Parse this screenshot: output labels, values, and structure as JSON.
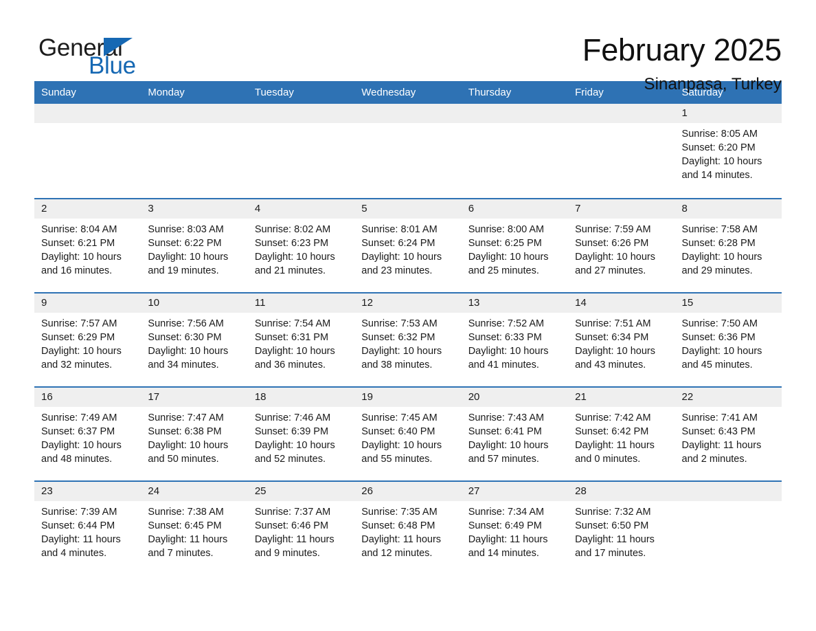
{
  "brand": {
    "name_part1": "General",
    "name_part2": "Blue",
    "flag_icon": "triangle-flag-icon"
  },
  "header": {
    "title": "February 2025",
    "subtitle": "Sinanpasa, Turkey"
  },
  "calendar": {
    "weekday_headers": [
      "Sunday",
      "Monday",
      "Tuesday",
      "Wednesday",
      "Thursday",
      "Friday",
      "Saturday"
    ],
    "header_bg": "#2e72b4",
    "daynum_bg": "#efefef",
    "row_divider": "#2e72b4",
    "weeks": [
      [
        {
          "day": "",
          "empty": true
        },
        {
          "day": "",
          "empty": true
        },
        {
          "day": "",
          "empty": true
        },
        {
          "day": "",
          "empty": true
        },
        {
          "day": "",
          "empty": true
        },
        {
          "day": "",
          "empty": true
        },
        {
          "day": "1",
          "sunrise": "Sunrise: 8:05 AM",
          "sunset": "Sunset: 6:20 PM",
          "daylight": "Daylight: 10 hours and 14 minutes."
        }
      ],
      [
        {
          "day": "2",
          "sunrise": "Sunrise: 8:04 AM",
          "sunset": "Sunset: 6:21 PM",
          "daylight": "Daylight: 10 hours and 16 minutes."
        },
        {
          "day": "3",
          "sunrise": "Sunrise: 8:03 AM",
          "sunset": "Sunset: 6:22 PM",
          "daylight": "Daylight: 10 hours and 19 minutes."
        },
        {
          "day": "4",
          "sunrise": "Sunrise: 8:02 AM",
          "sunset": "Sunset: 6:23 PM",
          "daylight": "Daylight: 10 hours and 21 minutes."
        },
        {
          "day": "5",
          "sunrise": "Sunrise: 8:01 AM",
          "sunset": "Sunset: 6:24 PM",
          "daylight": "Daylight: 10 hours and 23 minutes."
        },
        {
          "day": "6",
          "sunrise": "Sunrise: 8:00 AM",
          "sunset": "Sunset: 6:25 PM",
          "daylight": "Daylight: 10 hours and 25 minutes."
        },
        {
          "day": "7",
          "sunrise": "Sunrise: 7:59 AM",
          "sunset": "Sunset: 6:26 PM",
          "daylight": "Daylight: 10 hours and 27 minutes."
        },
        {
          "day": "8",
          "sunrise": "Sunrise: 7:58 AM",
          "sunset": "Sunset: 6:28 PM",
          "daylight": "Daylight: 10 hours and 29 minutes."
        }
      ],
      [
        {
          "day": "9",
          "sunrise": "Sunrise: 7:57 AM",
          "sunset": "Sunset: 6:29 PM",
          "daylight": "Daylight: 10 hours and 32 minutes."
        },
        {
          "day": "10",
          "sunrise": "Sunrise: 7:56 AM",
          "sunset": "Sunset: 6:30 PM",
          "daylight": "Daylight: 10 hours and 34 minutes."
        },
        {
          "day": "11",
          "sunrise": "Sunrise: 7:54 AM",
          "sunset": "Sunset: 6:31 PM",
          "daylight": "Daylight: 10 hours and 36 minutes."
        },
        {
          "day": "12",
          "sunrise": "Sunrise: 7:53 AM",
          "sunset": "Sunset: 6:32 PM",
          "daylight": "Daylight: 10 hours and 38 minutes."
        },
        {
          "day": "13",
          "sunrise": "Sunrise: 7:52 AM",
          "sunset": "Sunset: 6:33 PM",
          "daylight": "Daylight: 10 hours and 41 minutes."
        },
        {
          "day": "14",
          "sunrise": "Sunrise: 7:51 AM",
          "sunset": "Sunset: 6:34 PM",
          "daylight": "Daylight: 10 hours and 43 minutes."
        },
        {
          "day": "15",
          "sunrise": "Sunrise: 7:50 AM",
          "sunset": "Sunset: 6:36 PM",
          "daylight": "Daylight: 10 hours and 45 minutes."
        }
      ],
      [
        {
          "day": "16",
          "sunrise": "Sunrise: 7:49 AM",
          "sunset": "Sunset: 6:37 PM",
          "daylight": "Daylight: 10 hours and 48 minutes."
        },
        {
          "day": "17",
          "sunrise": "Sunrise: 7:47 AM",
          "sunset": "Sunset: 6:38 PM",
          "daylight": "Daylight: 10 hours and 50 minutes."
        },
        {
          "day": "18",
          "sunrise": "Sunrise: 7:46 AM",
          "sunset": "Sunset: 6:39 PM",
          "daylight": "Daylight: 10 hours and 52 minutes."
        },
        {
          "day": "19",
          "sunrise": "Sunrise: 7:45 AM",
          "sunset": "Sunset: 6:40 PM",
          "daylight": "Daylight: 10 hours and 55 minutes."
        },
        {
          "day": "20",
          "sunrise": "Sunrise: 7:43 AM",
          "sunset": "Sunset: 6:41 PM",
          "daylight": "Daylight: 10 hours and 57 minutes."
        },
        {
          "day": "21",
          "sunrise": "Sunrise: 7:42 AM",
          "sunset": "Sunset: 6:42 PM",
          "daylight": "Daylight: 11 hours and 0 minutes."
        },
        {
          "day": "22",
          "sunrise": "Sunrise: 7:41 AM",
          "sunset": "Sunset: 6:43 PM",
          "daylight": "Daylight: 11 hours and 2 minutes."
        }
      ],
      [
        {
          "day": "23",
          "sunrise": "Sunrise: 7:39 AM",
          "sunset": "Sunset: 6:44 PM",
          "daylight": "Daylight: 11 hours and 4 minutes."
        },
        {
          "day": "24",
          "sunrise": "Sunrise: 7:38 AM",
          "sunset": "Sunset: 6:45 PM",
          "daylight": "Daylight: 11 hours and 7 minutes."
        },
        {
          "day": "25",
          "sunrise": "Sunrise: 7:37 AM",
          "sunset": "Sunset: 6:46 PM",
          "daylight": "Daylight: 11 hours and 9 minutes."
        },
        {
          "day": "26",
          "sunrise": "Sunrise: 7:35 AM",
          "sunset": "Sunset: 6:48 PM",
          "daylight": "Daylight: 11 hours and 12 minutes."
        },
        {
          "day": "27",
          "sunrise": "Sunrise: 7:34 AM",
          "sunset": "Sunset: 6:49 PM",
          "daylight": "Daylight: 11 hours and 14 minutes."
        },
        {
          "day": "28",
          "sunrise": "Sunrise: 7:32 AM",
          "sunset": "Sunset: 6:50 PM",
          "daylight": "Daylight: 11 hours and 17 minutes."
        },
        {
          "day": "",
          "empty": true
        }
      ]
    ]
  }
}
